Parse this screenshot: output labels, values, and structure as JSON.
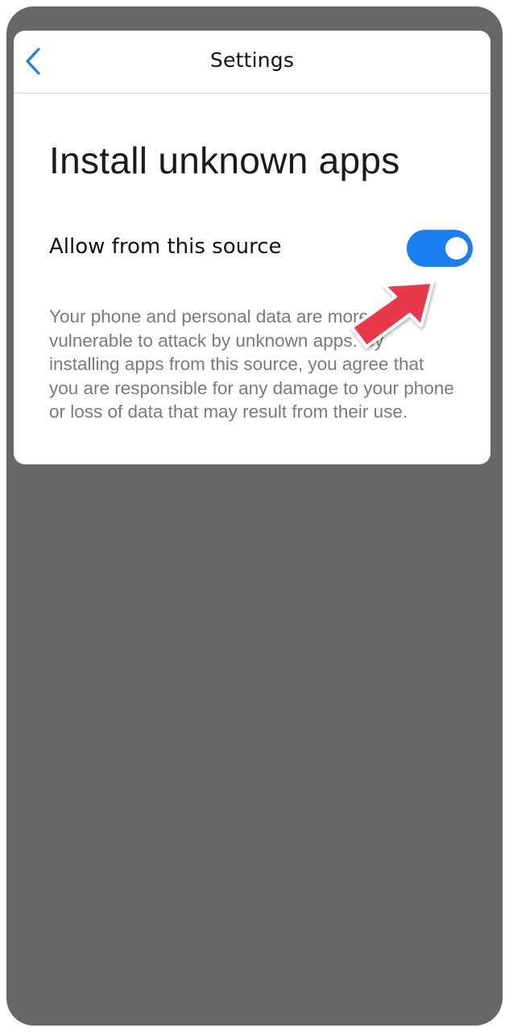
{
  "header": {
    "title": "Settings",
    "back_icon": "chevron-left-icon"
  },
  "page": {
    "title": "Install unknown apps"
  },
  "toggle": {
    "label": "Allow from this source",
    "state": "on"
  },
  "description": "Your phone and personal data are more vulnerable to attack by unknown apps. By installing apps from this source, you agree that you are responsible for any damage to your phone or loss of data that may result from their use.",
  "colors": {
    "accent": "#1a7ff0",
    "background": "#686868",
    "arrow": "#e8384a"
  }
}
